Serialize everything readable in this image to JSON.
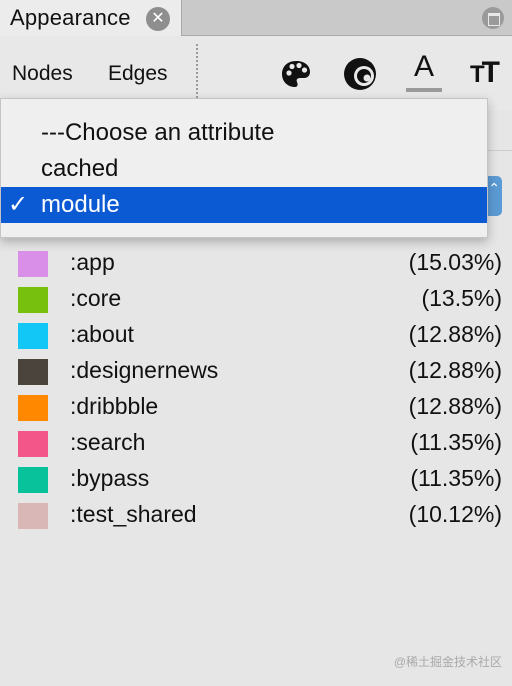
{
  "tab": {
    "title": "Appearance",
    "close_glyph": "✕"
  },
  "toolbar": {
    "nodes_label": "Nodes",
    "edges_label": "Edges",
    "icons": [
      "palette-icon",
      "size-icon",
      "label-color-icon",
      "label-size-icon"
    ],
    "font_glyph": "A",
    "size_glyph_small": "T",
    "size_glyph_big": "T"
  },
  "attribute_menu": {
    "items": [
      {
        "label": "---Choose an attribute",
        "selected": false
      },
      {
        "label": "cached",
        "selected": false
      },
      {
        "label": "module",
        "selected": true
      }
    ],
    "check_glyph": "✓",
    "accent_color": "#0b5ad4"
  },
  "legend": [
    {
      "name": ":app",
      "percent": "(15.03%)",
      "color": "#d98ee8"
    },
    {
      "name": ":core",
      "percent": "(13.5%)",
      "color": "#77c10e"
    },
    {
      "name": ":about",
      "percent": "(12.88%)",
      "color": "#12c6f5"
    },
    {
      "name": ":designernews",
      "percent": "(12.88%)",
      "color": "#4b443c"
    },
    {
      "name": ":dribbble",
      "percent": "(12.88%)",
      "color": "#ff8800"
    },
    {
      "name": ":search",
      "percent": "(11.35%)",
      "color": "#f3578a"
    },
    {
      "name": ":bypass",
      "percent": "(11.35%)",
      "color": "#07c29a"
    },
    {
      "name": ":test_shared",
      "percent": "(10.12%)",
      "color": "#d9b7b6"
    }
  ],
  "watermark": "@稀土掘金技术社区"
}
